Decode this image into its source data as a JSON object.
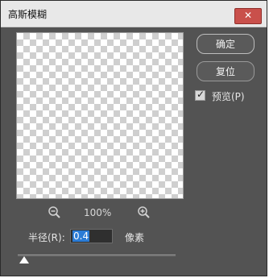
{
  "window": {
    "title": "高斯模糊"
  },
  "titlebar": {
    "close_glyph": "✕"
  },
  "buttons": {
    "ok_label": "确定",
    "reset_label": "复位"
  },
  "preview_option": {
    "label": "预览(P)",
    "checked": true
  },
  "zoom": {
    "level": "100%"
  },
  "radius": {
    "label": "半径(R):",
    "value": "0.4",
    "unit": "像素",
    "slider_fraction": 0.01
  },
  "icons": {
    "zoom_out": "zoom-out-icon",
    "zoom_in": "zoom-in-icon",
    "close": "close-icon",
    "check": "check-icon"
  }
}
